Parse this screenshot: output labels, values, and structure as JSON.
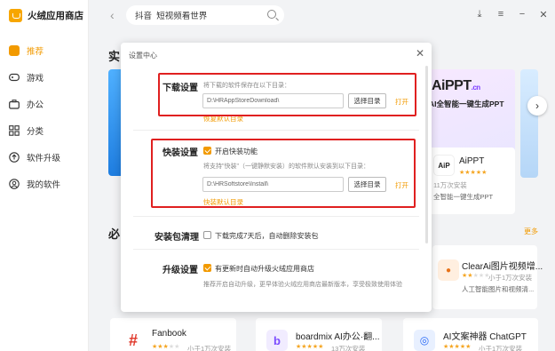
{
  "app": {
    "title": "火绒应用商店"
  },
  "sidebar": {
    "items": [
      {
        "label": "推荐",
        "icon": "recommend-icon"
      },
      {
        "label": "游戏",
        "icon": "gamepad-icon"
      },
      {
        "label": "办公",
        "icon": "briefcase-icon"
      },
      {
        "label": "分类",
        "icon": "category-icon"
      },
      {
        "label": "软件升级",
        "icon": "upgrade-icon"
      },
      {
        "label": "我的软件",
        "icon": "my-software-icon"
      }
    ]
  },
  "search": {
    "value": "抖音  短视频看世界"
  },
  "background": {
    "section1_heading": "实",
    "section2_heading": "必",
    "more": "更多",
    "banner": {
      "title": "AiPPT",
      "title_suffix": ".cn",
      "subtitle": "AI全智能一键生成PPT"
    },
    "aippt_card": {
      "name": "AiPPT",
      "users": "11万次安装",
      "desc": "全智能一键生成PPT"
    },
    "clearai_card": {
      "name": "ClearAi图片视频增...",
      "users": "小于1万次安装",
      "desc": "人工智能图片和视频清..."
    },
    "fanbook_card": {
      "name": "Fanbook",
      "users": "小于1万次安装"
    },
    "boardmix_card": {
      "name": "boardmix AI办公·翻...",
      "users": "13万次安装"
    },
    "aiwriter_card": {
      "name": "AI文案神器 ChatGPT",
      "users": "小于1万次安装"
    }
  },
  "settings": {
    "title": "设置中心",
    "download": {
      "label": "下载设置",
      "desc": "将下载的软件保存在以下目录：",
      "path": "D:\\HRAppStoreDownload\\",
      "choose": "选择目录",
      "open": "打开",
      "restore": "恢复默认目录"
    },
    "quick_install": {
      "label": "快装设置",
      "enable": "开启快装功能",
      "desc": "将支持\"快装\"（一键静默安装）的软件默认安装到以下目录：",
      "path": "D:\\HRSoftstore\\Install\\",
      "choose": "选择目录",
      "open": "打开",
      "restore": "快装默认目录",
      "checked": true
    },
    "cleanup": {
      "label": "安装包清理",
      "option": "下载完成7天后，自动删除安装包",
      "checked": false
    },
    "upgrade": {
      "label": "升级设置",
      "option": "有更新时自动升级火绒应用商店",
      "desc": "推荐开启自动升级，更早体验火绒应用商店最新版本，享受极致使用体验",
      "checked": true
    }
  },
  "colors": {
    "accent": "#f29a00",
    "highlight": "#e02020"
  }
}
